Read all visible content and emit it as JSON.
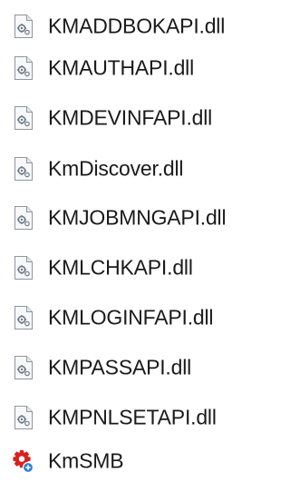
{
  "files": [
    {
      "name": "KMADDBOKAPI.dll",
      "icon": "dll-file-icon"
    },
    {
      "name": "KMAUTHAPI.dll",
      "icon": "dll-file-icon"
    },
    {
      "name": "KMDEVINFAPI.dll",
      "icon": "dll-file-icon"
    },
    {
      "name": "KmDiscover.dll",
      "icon": "dll-file-icon"
    },
    {
      "name": "KMJOBMNGAPI.dll",
      "icon": "dll-file-icon"
    },
    {
      "name": "KMLCHKAPI.dll",
      "icon": "dll-file-icon"
    },
    {
      "name": "KMLOGINFAPI.dll",
      "icon": "dll-file-icon"
    },
    {
      "name": "KMPASSAPI.dll",
      "icon": "dll-file-icon"
    },
    {
      "name": "KMPNLSETAPI.dll",
      "icon": "dll-file-icon"
    },
    {
      "name": "KmSMB",
      "icon": "app-icon"
    }
  ]
}
